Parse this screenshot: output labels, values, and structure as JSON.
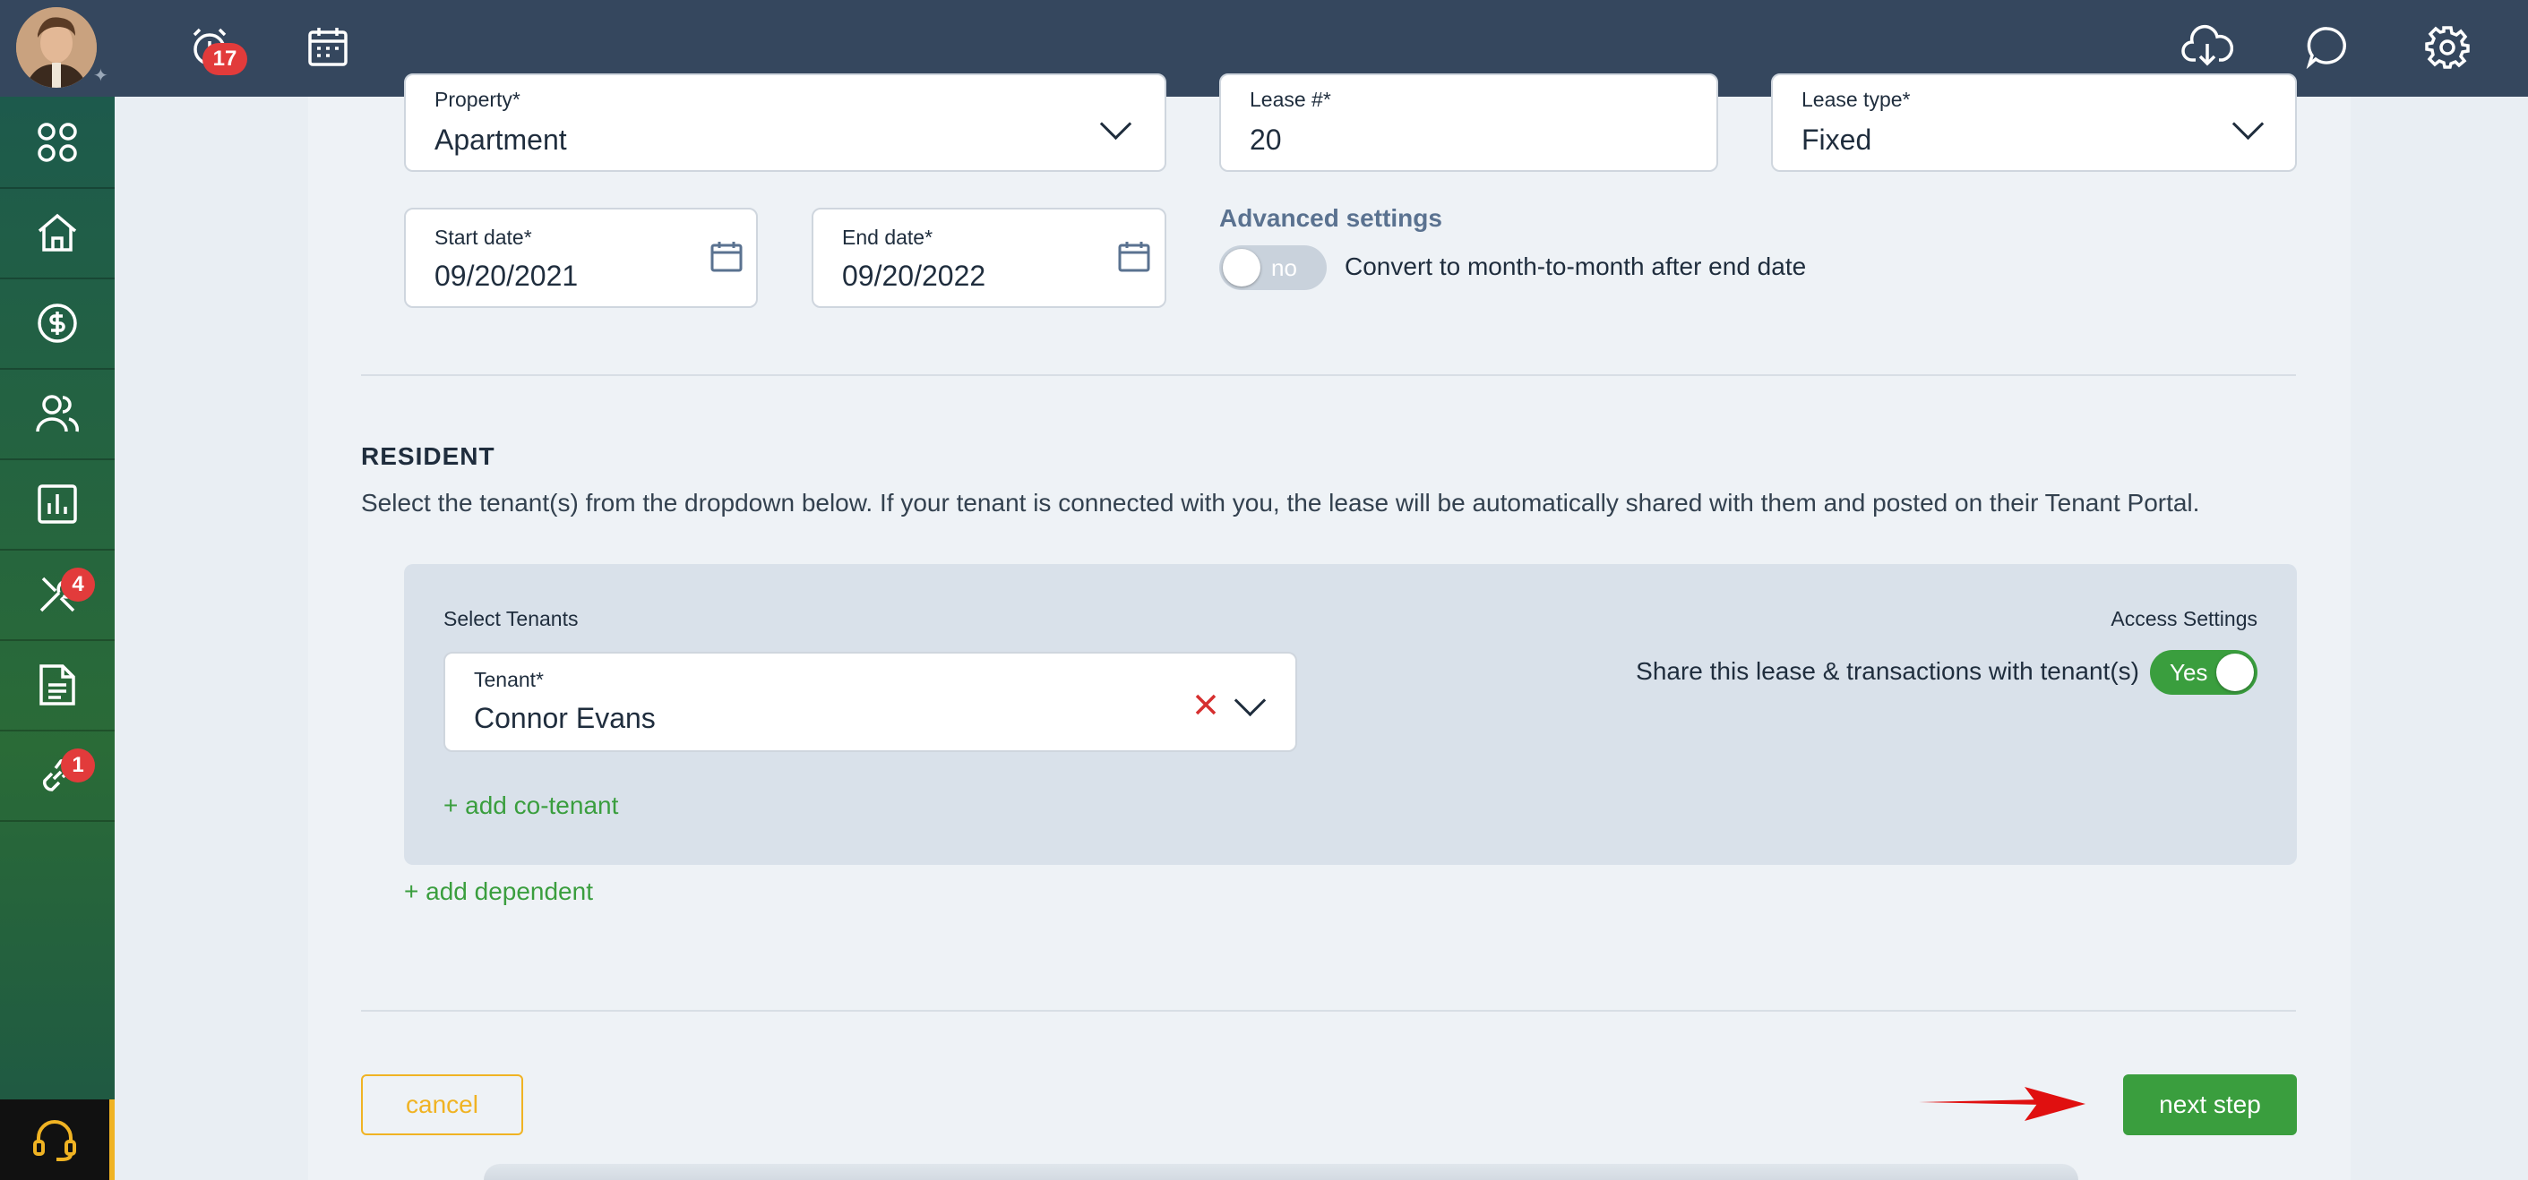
{
  "topbar": {
    "notifications_count": "17",
    "icons": [
      "alarm-clock-icon",
      "calendar-icon",
      "cloud-download-icon",
      "chat-icon",
      "gear-icon"
    ]
  },
  "sidebar": {
    "items": [
      {
        "name": "dashboard",
        "icon": "grid-icon"
      },
      {
        "name": "properties",
        "icon": "home-icon"
      },
      {
        "name": "accounting",
        "icon": "dollar-icon"
      },
      {
        "name": "people",
        "icon": "users-icon"
      },
      {
        "name": "reports",
        "icon": "bar-chart-icon"
      },
      {
        "name": "maintenance",
        "icon": "tools-icon",
        "badge": "4"
      },
      {
        "name": "documents",
        "icon": "document-icon"
      },
      {
        "name": "connections",
        "icon": "link-icon",
        "badge": "1"
      }
    ],
    "support_icon": "headset-icon"
  },
  "lease": {
    "property_label": "Property*",
    "property_value": "Apartment",
    "lease_num_label": "Lease #*",
    "lease_num_value": "20",
    "lease_type_label": "Lease type*",
    "lease_type_value": "Fixed",
    "start_label": "Start date*",
    "start_value": "09/20/2021",
    "end_label": "End date*",
    "end_value": "09/20/2022",
    "advanced_title": "Advanced settings",
    "m2m_toggle_value": "no",
    "m2m_label": "Convert to month-to-month after end date"
  },
  "resident": {
    "title": "RESIDENT",
    "description": "Select the tenant(s) from the dropdown below. If your tenant is connected with you, the lease will be automatically shared with them and posted on their Tenant Portal.",
    "select_tenants_label": "Select Tenants",
    "access_settings_label": "Access Settings",
    "tenant_label": "Tenant*",
    "tenant_value": "Connor Evans",
    "share_label": "Share this lease & transactions with tenant(s)",
    "share_toggle_value": "Yes",
    "add_cotenant": "+ add co-tenant",
    "add_dependent": "+ add dependent"
  },
  "actions": {
    "cancel": "cancel",
    "next": "next step"
  },
  "colors": {
    "topbar": "#35475e",
    "accent_green": "#3a9e3e",
    "cancel_yellow": "#f0b323",
    "badge_red": "#e23b3b",
    "arrow_red": "#e01010"
  }
}
